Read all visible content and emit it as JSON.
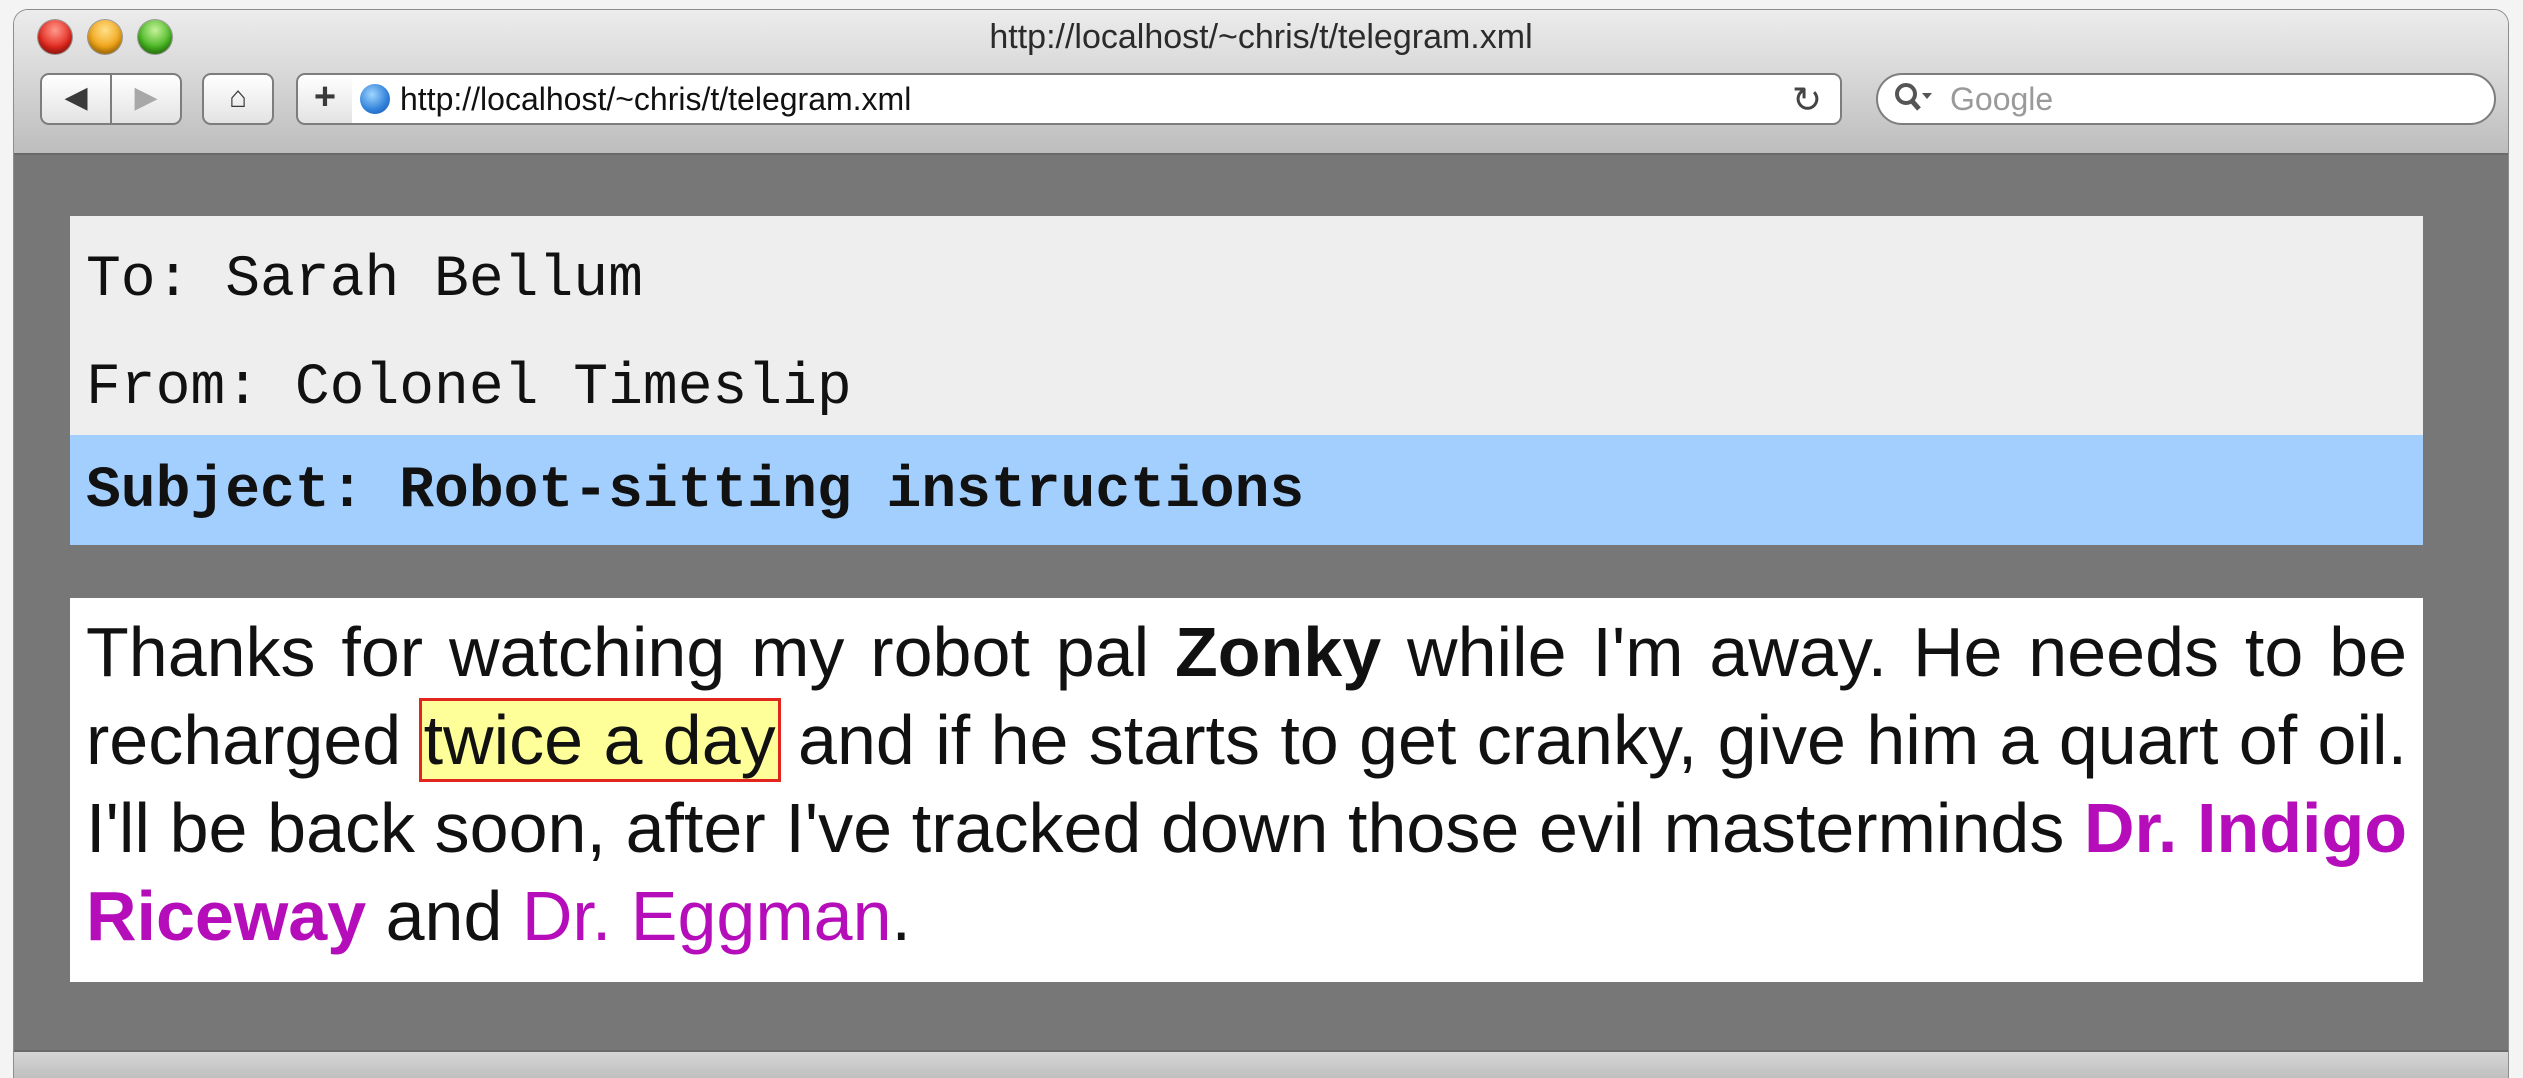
{
  "window": {
    "title": "http://localhost/~chris/t/telegram.xml"
  },
  "toolbar": {
    "back_icon": "◀",
    "forward_icon": "▶",
    "home_icon": "⌂",
    "add_label": "+",
    "url": "http://localhost/~chris/t/telegram.xml",
    "reload_icon": "↻",
    "search_placeholder": "Google"
  },
  "telegram": {
    "to_line": "To: Sarah Bellum",
    "from_line": "From: Colonel Timeslip",
    "subject_line": "Subject: Robot-sitting instructions",
    "body": {
      "seg1": "Thanks for watching my robot pal ",
      "robot_name": "Zonky",
      "seg2": " while I'm away. He needs to be recharged ",
      "highlight": "twice a day",
      "seg3": " and if he starts to get cranky, give him a quart of oil. I'll be back soon, after I've tracked down those evil masterminds ",
      "villain1": "Dr. Indigo Riceway",
      "seg4": " and ",
      "villain2": "Dr. Eggman",
      "seg5": "."
    }
  },
  "colors": {
    "page_background": "#777777",
    "header_background": "#eeeeee",
    "subject_background": "#a3cfff",
    "highlight_background": "#ffff99",
    "highlight_border": "#e0261f",
    "villain_color": "#b60dbb"
  }
}
